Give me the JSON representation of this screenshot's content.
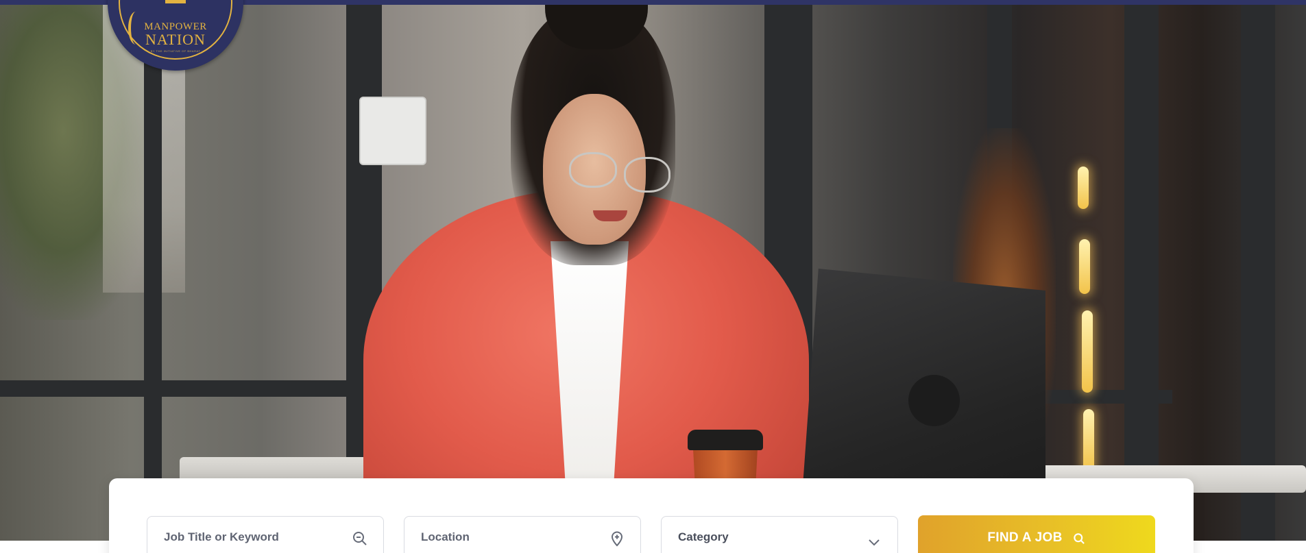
{
  "brand": {
    "logo_line1": "MANPOWER",
    "logo_line2": "NATION",
    "logo_tagline": "BY THE INITIATIVE OF BHARAT"
  },
  "colors": {
    "top_bar": "#2f3466",
    "logo_bg": "#2d3262",
    "logo_gold": "#e3b341",
    "button_gradient_start": "#e0a22b",
    "button_gradient_end": "#efd91d"
  },
  "hero": {
    "image_alt": "woman in coral blazer working on laptop at outdoor cafe"
  },
  "search": {
    "keyword": {
      "value": "",
      "placeholder": "Job Title or Keyword",
      "icon": "search-icon"
    },
    "location": {
      "value": "",
      "placeholder": "Location",
      "icon": "map-pin-icon"
    },
    "category": {
      "selected": "Category",
      "icon": "chevron-down-icon"
    },
    "submit": {
      "label": "FIND A JOB",
      "icon": "search-icon"
    }
  }
}
